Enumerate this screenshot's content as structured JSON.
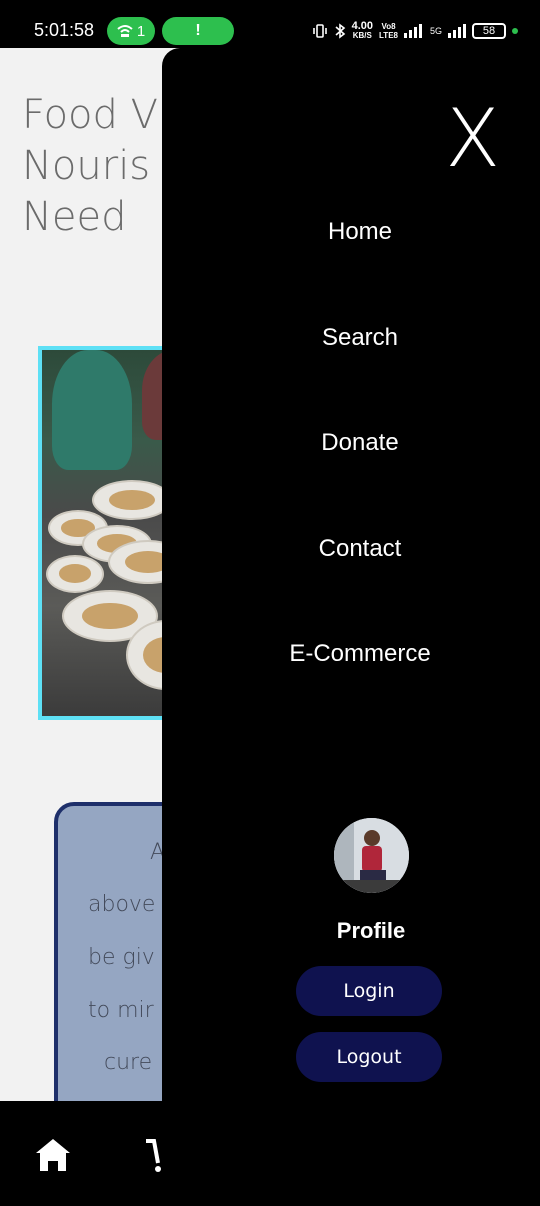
{
  "status_bar": {
    "time": "5:01:58",
    "hotspot_count": "1",
    "alert_glyph": "!",
    "net_speed_top": "4.00",
    "net_speed_bottom": "KB/S",
    "volte_top": "Vo8",
    "volte_bottom": "LTE8",
    "network": "5G",
    "battery": "58",
    "icons": [
      "vibrate-icon",
      "bluetooth-icon",
      "signal-icon",
      "battery-icon"
    ]
  },
  "page": {
    "hero_title_lines": [
      "Food V",
      "Nouris",
      "Need"
    ],
    "card_lines": [
      "A",
      "above",
      "be giv",
      "to mir",
      "cure"
    ]
  },
  "drawer": {
    "close_label": "X",
    "menu": [
      "Home",
      "Search",
      "Donate",
      "Contact",
      "E-Commerce"
    ],
    "profile_label": "Profile",
    "login_label": "Login",
    "logout_label": "Logout"
  },
  "bottom_nav": {
    "icons": [
      "home-icon",
      "cart-icon"
    ]
  },
  "colors": {
    "drawer_bg": "#000000",
    "button_bg": "#0f124f",
    "photo_border": "#5ee0f5",
    "card_bg": "#95a6c2",
    "card_border": "#1e2f6a",
    "status_pill": "#2dbf4e"
  }
}
